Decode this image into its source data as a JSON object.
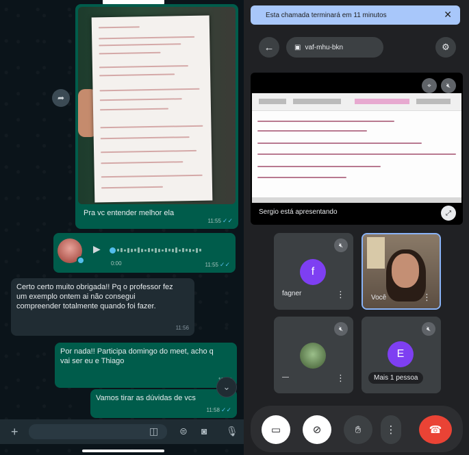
{
  "chat": {
    "image_message": {
      "caption": "Pra vc entender melhor ela",
      "time": "11:55"
    },
    "audio_message": {
      "duration": "0:00",
      "time": "11:55"
    },
    "incoming_message": {
      "text": "Certo certo muito obrigada!! Pq o professor fez um exemplo ontem ai não consegui compreender totalmente quando foi fazer.",
      "time": "11:56"
    },
    "outgoing_message_1": {
      "text": "Por nada!! Participa domingo do meet, acho q vai ser eu e Thiago",
      "time": "11:57"
    },
    "outgoing_message_2": {
      "text": "Vamos tirar as dúvidas de vcs",
      "time": "11:58"
    },
    "input": {
      "placeholder": ""
    },
    "icons": {
      "forward": "share-icon",
      "scroll_down": "chevron-down-icon",
      "attach": "plus-icon",
      "sticker": "sticker-icon",
      "camera": "camera-icon",
      "mic": "mic-icon"
    }
  },
  "meet": {
    "banner": {
      "text": "Esta chamada terminará em 11 minutos",
      "close": "✕"
    },
    "meeting_code": "vaf-mhu-bkn",
    "presentation": {
      "label": "Sergio está apresentando"
    },
    "participants": [
      {
        "name": "fagner",
        "initial": "f"
      },
      {
        "name": "Você",
        "initial": ""
      },
      {
        "name": "—",
        "initial": ""
      },
      {
        "name": "Mais 1 pessoa",
        "initial": "E"
      }
    ],
    "colors": {
      "accent": "#8ab4f8",
      "avatar_purple": "#7e3ff2",
      "end_call": "#ea4335",
      "banner": "#a8c7fa"
    }
  }
}
